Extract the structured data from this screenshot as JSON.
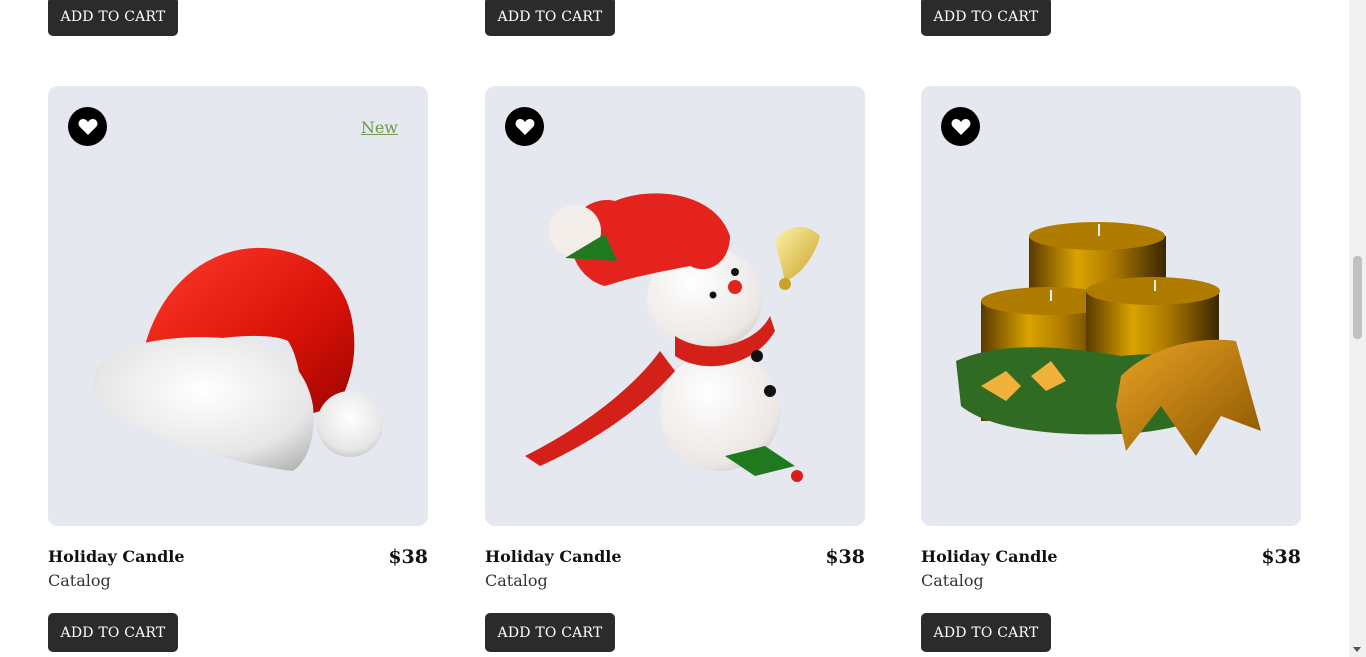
{
  "top_row": {
    "buttons": [
      {
        "label": "ADD TO CART"
      },
      {
        "label": "ADD TO CART"
      },
      {
        "label": "ADD TO CART"
      }
    ]
  },
  "products": [
    {
      "title": "Holiday Candle",
      "category": "Catalog",
      "price": "$38",
      "badge": "New",
      "image": "santa-hat-image",
      "button_label": "ADD TO CART"
    },
    {
      "title": "Holiday Candle",
      "category": "Catalog",
      "price": "$38",
      "badge": "",
      "image": "snowman-with-bell-image",
      "button_label": "ADD TO CART"
    },
    {
      "title": "Holiday Candle",
      "category": "Catalog",
      "price": "$38",
      "badge": "",
      "image": "golden-candles-image",
      "button_label": "ADD TO CART"
    }
  ],
  "icons": {
    "favorite": "heart-icon"
  },
  "colors": {
    "button_bg": "#2b2b2b",
    "card_bg": "#e5e8ee",
    "badge": "#6f9a4c"
  }
}
